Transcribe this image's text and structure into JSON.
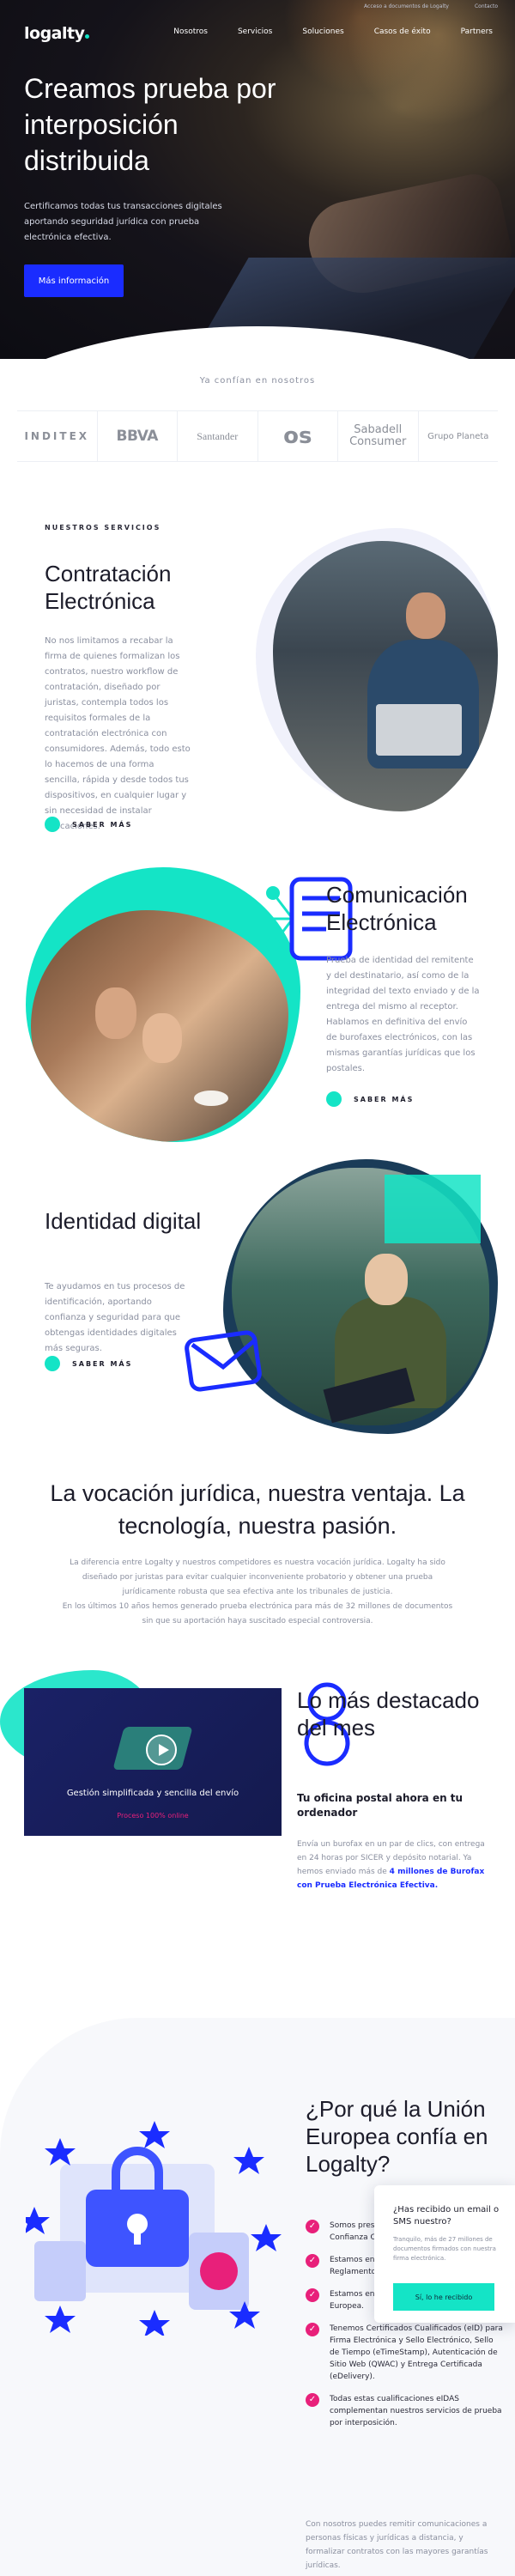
{
  "topbar": {
    "left": "Acceso a documentos de Logalty",
    "right": "Contacto"
  },
  "brand": {
    "logo": "logalty",
    "accent": "#14e4c6",
    "blue": "#1a2cff",
    "pink": "#e8207a"
  },
  "nav": [
    "Nosotros",
    "Servicios",
    "Soluciones",
    "Casos de éxito",
    "Partners"
  ],
  "hero": {
    "title": "Creamos prueba por interposición distribuida",
    "subtitle": "Certificamos todas tus transacciones digitales aportando seguridad jurídica con prueba electrónica efectiva.",
    "cta": "Más información"
  },
  "trust": {
    "title": "Ya confían en nosotros",
    "logos": [
      "INDITEX",
      "BBVA",
      "Santander",
      "os",
      "Sabadell Consumer",
      "Grupo Planeta"
    ]
  },
  "services": {
    "kicker": "NUESTROS SERVICIOS",
    "items": [
      {
        "title": "Contratación Electrónica",
        "text": "No nos limitamos a recabar la firma de quienes formalizan los contratos, nuestro workflow de contratación, diseñado por juristas, contempla todos los requisitos formales de la contratación electrónica con consumidores. Además, todo esto lo hacemos de una forma sencilla, rápida y desde todos tus dispositivos, en cualquier lugar y sin necesidad de instalar aplicaciones.",
        "more": "SABER MÁS"
      },
      {
        "title": "Comunicación Electrónica",
        "text": "Prueba de identidad del remitente y del destinatario, así como de la integridad del texto enviado y de la entrega del mismo al receptor. Hablamos en definitiva del envío de burofaxes electrónicos, con las mismas garantías jurídicas que los postales.",
        "more": "SABER MÁS"
      },
      {
        "title": "Identidad digital",
        "text": "Te ayudamos en tus procesos de identificación, aportando confianza y seguridad para que obtengas identidades digitales más seguras.",
        "more": "SABER MÁS"
      }
    ]
  },
  "vocation": {
    "title": "La vocación jurídica, nuestra ventaja. La tecnología, nuestra pasión.",
    "text1": "La diferencia entre Logalty y nuestros competidores es nuestra vocación jurídica. Logalty ha sido diseñado por juristas para evitar cualquier inconveniente probatorio y obtener una prueba jurídicamente robusta que sea efectiva ante los tribunales de justicia.",
    "text2": "En los últimos 10 años hemos generado prueba electrónica para más de 32 millones de documentos sin que su aportación haya suscitado especial controversia."
  },
  "video": {
    "caption": "Gestión simplificada y sencilla del envío",
    "tag": "Proceso 100% online"
  },
  "featured": {
    "title": "Lo más destacado del mes",
    "subtitle": "Tu oficina postal ahora en tu ordenador",
    "text": "Envía un burofax en un par de clics, con entrega en 24 horas por SICER y depósito notarial. Ya hemos enviado más de ",
    "highlight": "4 millones de Burofax con Prueba Electrónica Efectiva."
  },
  "eu": {
    "title": "¿Por qué la Unión Europea confía en Logalty?",
    "checks": [
      "Somos prestadores de Servicios de Confianza Cualificados.",
      "Estamos en la lista de confianza eIDAS, Reglamento (UE) 910/2014 de 23 de julio.",
      "Estamos en la lista de confianza de la Unión Europea.",
      "Tenemos Certificados Cualificados (eID) para Firma Electrónica y Sello Electrónico, Sello de Tiempo (eTimeStamp), Autenticación de Sitio Web (QWAC) y Entrega Certificada (eDelivery).",
      "Todas estas cualificaciones eIDAS complementan nuestros servicios de prueba por interposición."
    ],
    "text": "Con nosotros puedes remitir comunicaciones a personas físicas y jurídicas a distancia, y formalizar contratos con las mayores garantías jurídicas."
  },
  "popup": {
    "title": "¿Has recibido un email o SMS nuestro?",
    "text": "Tranquilo, más de 27 millones de documentos firmados con nuestra firma electrónica.",
    "button": "Sí, lo he recibido"
  }
}
